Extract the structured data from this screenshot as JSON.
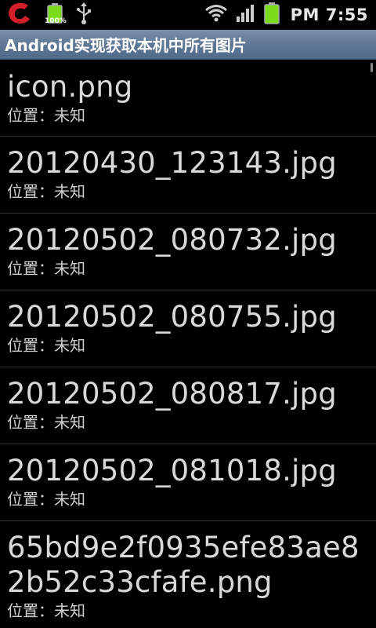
{
  "status_bar": {
    "battery_small_label": "100%",
    "time": "PM 7:55",
    "icons": [
      "c-app-icon",
      "battery-full-icon",
      "usb-icon",
      "wifi-icon",
      "signal-icon",
      "battery-icon"
    ],
    "colors": {
      "app_icon": "#d21f2a",
      "battery": "#7bdc1a"
    }
  },
  "title_bar": {
    "title": "Android实现获取本机中所有图片"
  },
  "list": {
    "items": [
      {
        "name": "icon.png",
        "location": "位置：未知"
      },
      {
        "name": "20120430_123143.jpg",
        "location": "位置：未知"
      },
      {
        "name": "20120502_080732.jpg",
        "location": "位置：未知"
      },
      {
        "name": "20120502_080755.jpg",
        "location": "位置：未知"
      },
      {
        "name": "20120502_080817.jpg",
        "location": "位置：未知"
      },
      {
        "name": "20120502_081018.jpg",
        "location": "位置：未知"
      },
      {
        "name": "65bd9e2f0935efe83ae82b52c33cfafe.png",
        "location": "位置：未知"
      }
    ]
  }
}
